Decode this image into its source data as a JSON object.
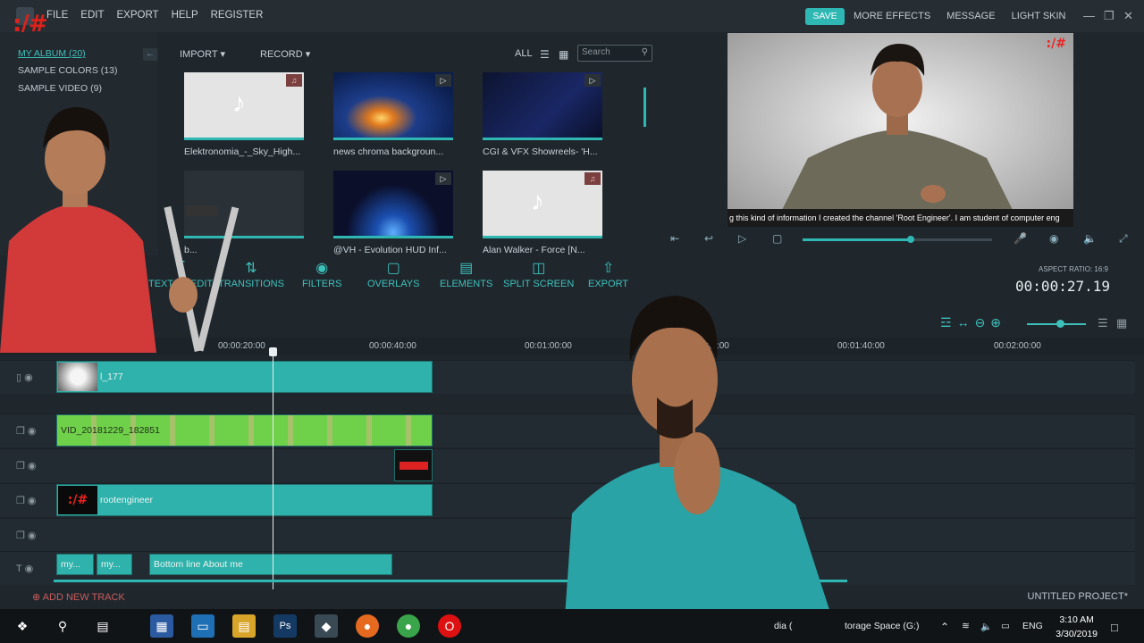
{
  "menu": [
    "FILE",
    "EDIT",
    "EXPORT",
    "HELP",
    "REGISTER"
  ],
  "logo_text": ":/#",
  "header_right": {
    "save": "SAVE",
    "more_effects": "MORE EFFECTS",
    "message": "MESSAGE",
    "light_skin": "LIGHT SKIN"
  },
  "album": {
    "items": [
      "MY ALBUM (20)",
      "SAMPLE COLORS (13)",
      "SAMPLE VIDEO (9)"
    ]
  },
  "media_toolbar": {
    "import": "IMPORT",
    "record": "RECORD",
    "all": "ALL",
    "search_placeholder": "Search"
  },
  "media_items": [
    {
      "label": "Elektronomia_-_Sky_High...",
      "type": "audio"
    },
    {
      "label": "news chroma backgroun...",
      "type": "video"
    },
    {
      "label": "CGI & VFX Showreels- 'H...",
      "type": "video"
    },
    {
      "label": "b...",
      "type": "video"
    },
    {
      "label": "@VH - Evolution HUD Inf...",
      "type": "video"
    },
    {
      "label": "Alan Walker - Force [N...",
      "type": "audio"
    }
  ],
  "preview": {
    "subtitle": "g this kind of information I created the channel 'Root Engineer'. I am student of computer eng",
    "watermark": ":/#"
  },
  "edit_tools": [
    "TEXT/CREDIT",
    "TRANSITIONS",
    "FILTERS",
    "OVERLAYS",
    "ELEMENTS",
    "SPLIT SCREEN",
    "EXPORT"
  ],
  "aspect_ratio": "ASPECT RATIO: 16:9",
  "timecode": "00:00:27.19",
  "ruler": [
    "00:00:20:00",
    "00:00:40:00",
    "00:01:00:00",
    "00:01:20:00",
    "00:01:40:00",
    "00:02:00:00"
  ],
  "clips": {
    "track1": "l_177",
    "track2": "VID_20181229_182851",
    "track4": "rootengineer",
    "text1": "my...",
    "text2": "my...",
    "text3": "Bottom line About me"
  },
  "add_track": "ADD NEW TRACK",
  "project_name": "UNTITLED PROJECT*",
  "taskbar": {
    "tray_text1": "dia (",
    "tray_text2": "torage Space (G:)",
    "lang": "ENG",
    "time": "3:10 AM",
    "date": "3/30/2019"
  },
  "colors": {
    "accent": "#2fb8b3",
    "brand_red": "#e0201a",
    "bg": "#1f272d"
  },
  "playback_progress": 0.57
}
